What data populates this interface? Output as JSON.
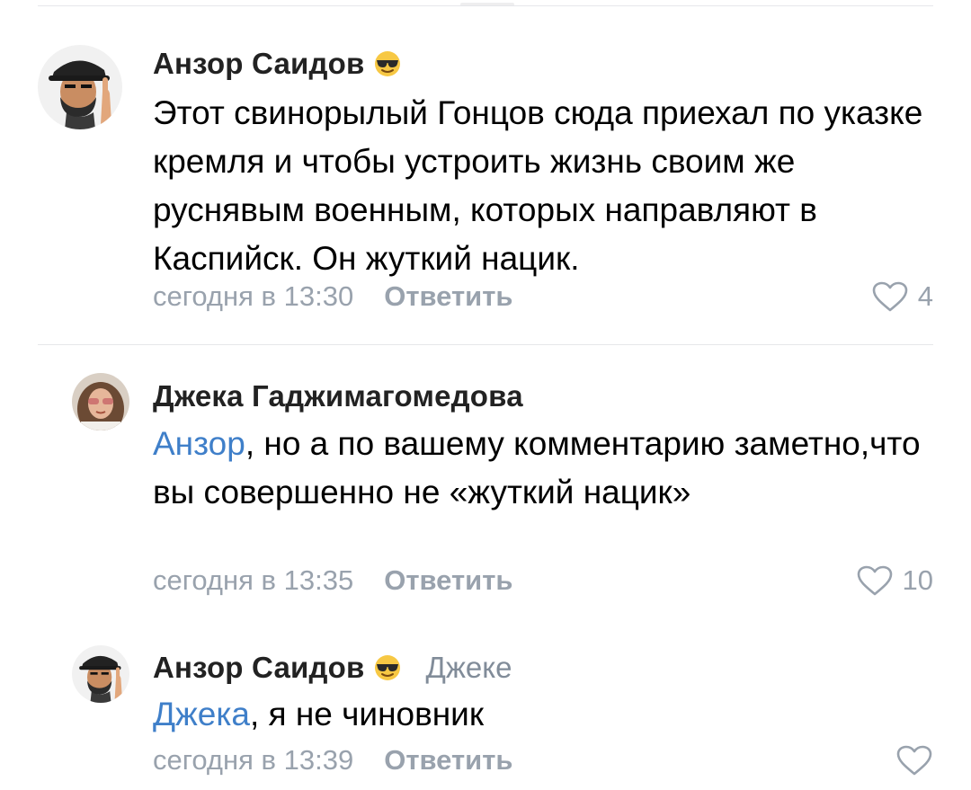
{
  "comments": [
    {
      "author": "Анзор Саидов",
      "has_emoji": true,
      "emoji_icon": "smiling-face-with-sunglasses-icon",
      "reply_to": "",
      "mention": "",
      "text": "Этот свинорылый Гонцов сюда приехал по указке кремля и чтобы устроить жизнь своим же руснявым военным, которых направляют в Каспийск. Он жуткий нацик.",
      "time": "сегодня в 13:30",
      "reply_label": "Ответить",
      "likes": "4"
    },
    {
      "author": "Джека Гаджимагомедова",
      "has_emoji": false,
      "reply_to": "",
      "mention": "Анзор",
      "text": ", но а по вашему комментарию заметно,что вы совершенно не «жуткий нацик»",
      "time": "сегодня в 13:35",
      "reply_label": "Ответить",
      "likes": "10"
    },
    {
      "author": "Анзор Саидов",
      "has_emoji": true,
      "emoji_icon": "smiling-face-with-sunglasses-icon",
      "reply_to": "Джеке",
      "mention": "Джека",
      "text": ", я не чиновник",
      "time": "сегодня в 13:39",
      "reply_label": "Ответить",
      "likes": ""
    }
  ],
  "colors": {
    "link": "#3f7fc9",
    "meta": "#99a2ad",
    "divider": "#e6e7ea"
  }
}
